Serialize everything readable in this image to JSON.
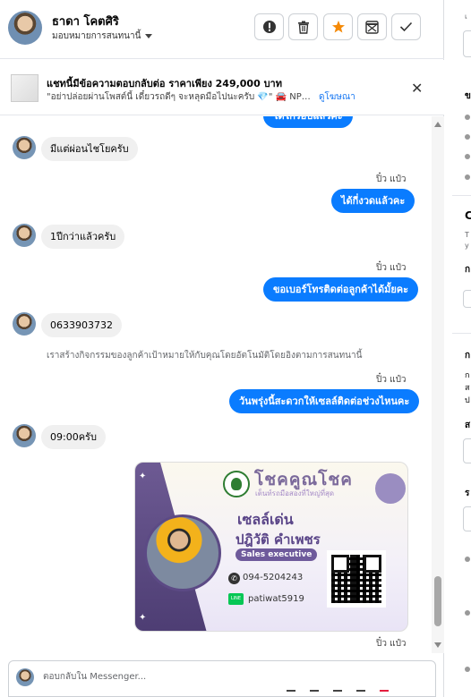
{
  "header": {
    "contact_name": "ธาดา โคตศิริ",
    "assign_label": "มอบหมายการสนทนานี้",
    "buttons": [
      "alert-button",
      "delete-button",
      "star-button",
      "archive-button",
      "done-button"
    ]
  },
  "banner": {
    "title": "แชทนี้มีข้อความตอบกลับต่อ ราคาเพียง 249,000 บาท",
    "subtitle": "\"อย่าปล่อยผ่านโพสต์นี้ เดี๋ยวรถดีๆ จะหลุดมือไปนะครับ 💎\" 🚘 NP300 N...",
    "link": "ดูโฆษณา",
    "close_symbol": "✕"
  },
  "messages": {
    "m0": "ได้ไก่รอบแล้วค่ะ",
    "m1": "มีแต่ผ่อนไชโยครับ",
    "s1": "ปิ๋ว แป๋ว",
    "m2": "ได้กี่งวดแล้วคะ",
    "m3": "1ปีกว่าแล้วครับ",
    "s2": "ปิ๋ว แป๋ว",
    "m4": "ขอเบอร์โทรติดต่อลูกค้าได้มั้ยคะ",
    "m5": "0633903732",
    "note": "เราสร้างกิจกรรมของลูกค้าเป้าหมายให้กับคุณโดยอัตโนมัติโดยอิงตามการสนทนานี้",
    "s3": "ปิ๋ว แป๋ว",
    "m6": "วันพรุ่งนี้สะดวกให้เซลล์ติดต่อช่วงไหนคะ",
    "m7": "09:00ครับ",
    "s4": "ปิ๋ว แป๋ว"
  },
  "card": {
    "brand": "โชคคูณโชค",
    "tagline": "เต็นท์รถมือสองที่ใหญ่ที่สุด",
    "line1": "เซลล์เด่น",
    "name": "ปฎิวัติ คำเพชร",
    "role": "Sales executive",
    "phone": "094-5204243",
    "line_id": "patiwat5919"
  },
  "reply": {
    "placeholder": "ตอบกลับใน Messenger..."
  },
  "rpanel": {
    "t1": "เ",
    "t2": "ข",
    "t3": "C",
    "t4": "T",
    "t5": "y",
    "t6": "ก",
    "t7": "ก",
    "t8": "ก",
    "t9": "ส",
    "t10": "ป",
    "t11": "ส",
    "t12": "ร"
  }
}
